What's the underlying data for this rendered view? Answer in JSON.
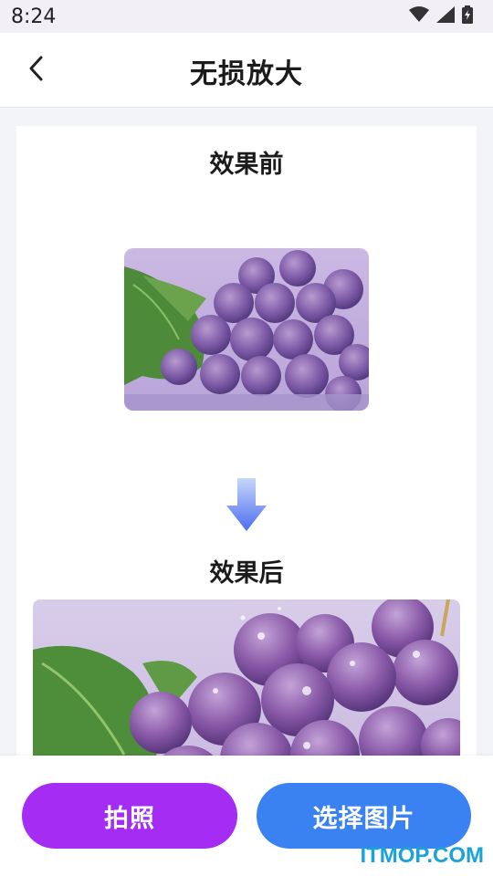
{
  "status_bar": {
    "time": "8:24",
    "icons": [
      "wifi-icon",
      "signal-icon",
      "battery-icon"
    ]
  },
  "header": {
    "title": "无损放大",
    "back_icon": "chevron-left-icon"
  },
  "comparison": {
    "before_label": "效果前",
    "after_label": "效果后",
    "before_image": "grapes-image-before",
    "after_image": "grapes-image-after",
    "arrow_icon": "arrow-down-icon"
  },
  "actions": {
    "take_photo_label": "拍照",
    "choose_image_label": "选择图片",
    "take_photo_color": "#a42cf3",
    "choose_image_color": "#3a82f1"
  },
  "watermark": "ITMOP.COM"
}
